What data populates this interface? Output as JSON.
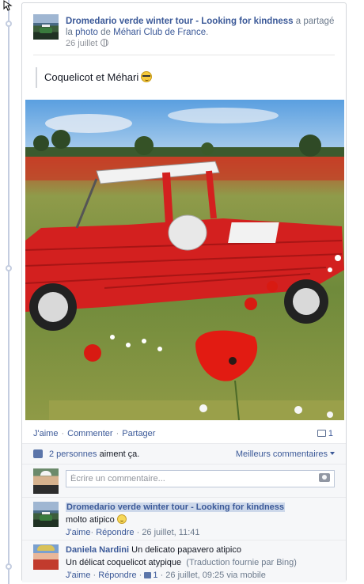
{
  "post": {
    "author": "Dromedario verde winter tour - Looking for kindness",
    "action_text_1": " a partagé la ",
    "action_link": "photo",
    "action_text_2": " de ",
    "page_name": "Méhari Club de France",
    "period": ".",
    "date": "26 juillet",
    "caption": "Coquelicot et Méhari"
  },
  "actions": {
    "like": "J'aime",
    "comment": "Commenter",
    "share": "Partager",
    "separator": "·",
    "comment_count": "1"
  },
  "likes": {
    "count_link": "2 personnes",
    "suffix": " aiment ça.",
    "best_comments": "Meilleurs commentaires"
  },
  "composer": {
    "placeholder": "Écrire un commentaire..."
  },
  "comments": [
    {
      "author": "Dromedario verde winter tour - Looking for kindness",
      "text": "molto atipico",
      "like": "J'aime",
      "reply": "Répondre",
      "date": "26 juillet, 11:41"
    },
    {
      "author": "Daniela Nardini",
      "text": " Un delicato papavero atipico",
      "translation": "Un délicat coquelicot atypique",
      "translation_note": "(Traduction fournie par Bing)",
      "like": "J'aime",
      "reply": "Répondre",
      "like_count": "1",
      "date": "26 juillet, 09:25 via mobile"
    }
  ],
  "colors": {
    "link": "#3b5998",
    "muted": "#90949c",
    "panel": "#f6f7f9"
  }
}
